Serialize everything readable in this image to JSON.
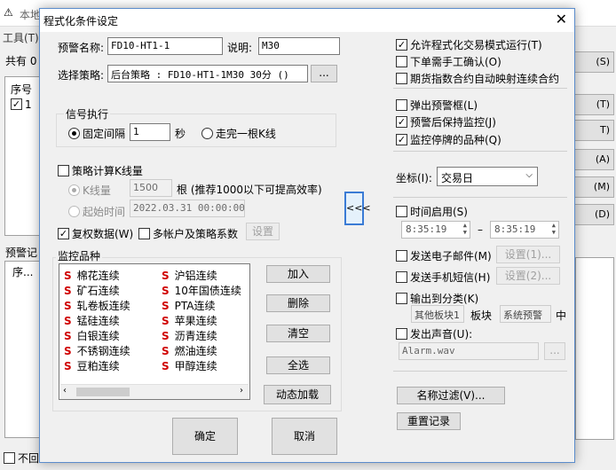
{
  "background": {
    "title": "本地",
    "menu_tools": "工具(T)",
    "count_prefix": "共有 0",
    "col_seq": "序号",
    "row_first": "1",
    "warn_log": "预警记",
    "col_seq2": "序...",
    "bottom_cb": "不回",
    "right_btns": [
      "(S)",
      "(T)",
      "T)",
      "(A)",
      "(M)",
      "(D)"
    ]
  },
  "dialog": {
    "title": "程式化条件设定",
    "close": "✕",
    "name_label": "预警名称:",
    "name_value": "FD10-HT1-1",
    "desc_label": "说明:",
    "desc_value": "M30",
    "strategy_label": "选择策略:",
    "strategy_value": "后台策略 : FD10-HT1-1M30 30分 ()",
    "strategy_btn": "...",
    "signal": {
      "group": "信号执行",
      "fixed_label": "固定间隔",
      "fixed_value": "1",
      "sec_unit": "秒",
      "walk_kline": "走完一根K线"
    },
    "calc": {
      "label": "策略计算K线量",
      "kline_qty": "K线量",
      "kline_value": "1500",
      "kline_hint": "根 (推荐1000以下可提高效率)",
      "start_time": "起始时间",
      "start_value": "2022.03.31 00:00:00"
    },
    "fuquan": "复权数据(W)",
    "multi_acct": "多帐户及策略系数",
    "set_btn": "设置",
    "monitor": {
      "group": "监控品种",
      "col1": [
        "棉花连续",
        "矿石连续",
        "轧卷板连续",
        "锰硅连续",
        "白银连续",
        "不锈钢连续",
        "豆粕连续"
      ],
      "col2": [
        "沪铝连续",
        "10年国债连续",
        "PTA连续",
        "苹果连续",
        "沥青连续",
        "燃油连续",
        "甲醇连续"
      ],
      "marker": "S"
    },
    "side_btns": {
      "add": "加入",
      "del": "删除",
      "clear": "清空",
      "all": "全选",
      "dyn": "动态加载"
    },
    "collapse_btn": "<<<",
    "ok": "确定",
    "cancel": "取消",
    "right": {
      "allow_prog": "允许程式化交易模式运行(T)",
      "manual_confirm": "下单需手工确认(O)",
      "auto_map": "期货指数合约自动映射连续合约",
      "popup": "弹出预警框(L)",
      "keep_monitor": "预警后保持监控(J)",
      "monitor_halt": "监控停牌的品种(Q)",
      "coord_label": "坐标(I):",
      "coord_value": "交易日",
      "time_enable": "时间启用(S)",
      "time_from": "8:35:19",
      "time_dash": "–",
      "time_to": "8:35:19",
      "email": "发送电子邮件(M)",
      "email_set": "设置(1)...",
      "sms": "发送手机短信(H)",
      "sms_set": "设置(2)...",
      "output_cat": "输出到分类(K)",
      "other_block": "其他板块1",
      "block_label": "板块",
      "block_value": "系统预警",
      "zhong": "中",
      "sound": "发出声音(U):",
      "sound_file": "Alarm.wav",
      "sound_btn": "...",
      "name_filter": "名称过滤(V)...",
      "reset_record": "重置记录"
    }
  }
}
